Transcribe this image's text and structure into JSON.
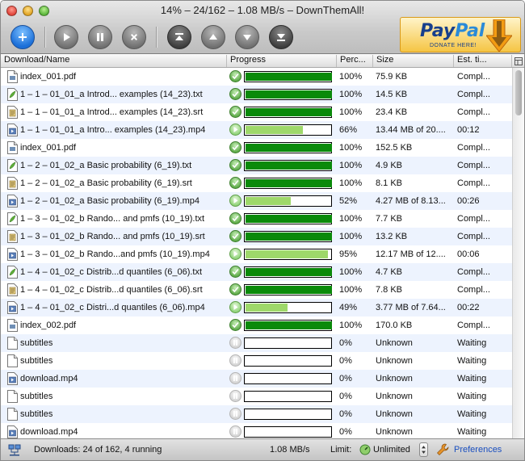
{
  "window": {
    "title": "14% – 24/162 – 1.08 MB/s – DownThemAll!"
  },
  "toolbar": {
    "buttons": [
      "add-icon",
      "resume-icon",
      "pause-icon",
      "cancel-icon",
      "move-top-icon",
      "move-up-icon",
      "move-down-icon",
      "move-bottom-icon"
    ]
  },
  "donate": {
    "brand_pay": "Pay",
    "brand_pal": "Pal",
    "label": "DONATE HERE!"
  },
  "columns": {
    "name": "Download/Name",
    "progress": "Progress",
    "percent": "Perc...",
    "size": "Size",
    "est": "Est. ti..."
  },
  "rows": [
    {
      "icon": "pdf",
      "name": "index_001.pdf",
      "state": "done",
      "progress": 1.0,
      "percent": "100%",
      "size": "75.9 KB",
      "est": "Compl..."
    },
    {
      "icon": "txt",
      "name": "1 – 1 – 01_01_a Introd... examples (14_23).txt",
      "state": "done",
      "progress": 1.0,
      "percent": "100%",
      "size": "14.5 KB",
      "est": "Compl..."
    },
    {
      "icon": "srt",
      "name": "1 – 1 – 01_01_a Introd... examples (14_23).srt",
      "state": "done",
      "progress": 1.0,
      "percent": "100%",
      "size": "23.4 KB",
      "est": "Compl..."
    },
    {
      "icon": "mp4",
      "name": "1 – 1 – 01_01_a Intro... examples (14_23).mp4",
      "state": "run",
      "progress": 0.66,
      "percent": "66%",
      "size": "13.44 MB of 20....",
      "est": "00:12"
    },
    {
      "icon": "pdf",
      "name": "index_001.pdf",
      "state": "done",
      "progress": 1.0,
      "percent": "100%",
      "size": "152.5 KB",
      "est": "Compl..."
    },
    {
      "icon": "txt",
      "name": "1 – 2 – 01_02_a Basic probability  (6_19).txt",
      "state": "done",
      "progress": 1.0,
      "percent": "100%",
      "size": "4.9 KB",
      "est": "Compl..."
    },
    {
      "icon": "srt",
      "name": "1 – 2 – 01_02_a Basic probability  (6_19).srt",
      "state": "done",
      "progress": 1.0,
      "percent": "100%",
      "size": "8.1 KB",
      "est": "Compl..."
    },
    {
      "icon": "mp4",
      "name": "1 – 2 – 01_02_a Basic probability  (6_19).mp4",
      "state": "run",
      "progress": 0.52,
      "percent": "52%",
      "size": "4.27 MB of 8.13...",
      "est": "00:26"
    },
    {
      "icon": "txt",
      "name": "1 – 3 – 01_02_b Rando... and pmfs (10_19).txt",
      "state": "done",
      "progress": 1.0,
      "percent": "100%",
      "size": "7.7 KB",
      "est": "Compl..."
    },
    {
      "icon": "srt",
      "name": "1 – 3 – 01_02_b Rando... and pmfs (10_19).srt",
      "state": "done",
      "progress": 1.0,
      "percent": "100%",
      "size": "13.2 KB",
      "est": "Compl..."
    },
    {
      "icon": "mp4",
      "name": "1 – 3 – 01_02_b Rando...and pmfs (10_19).mp4",
      "state": "run",
      "progress": 0.95,
      "percent": "95%",
      "size": "12.17 MB of 12....",
      "est": "00:06"
    },
    {
      "icon": "txt",
      "name": "1 – 4 – 01_02_c Distrib...d quantiles (6_06).txt",
      "state": "done",
      "progress": 1.0,
      "percent": "100%",
      "size": "4.7 KB",
      "est": "Compl..."
    },
    {
      "icon": "srt",
      "name": "1 – 4 – 01_02_c Distrib...d quantiles (6_06).srt",
      "state": "done",
      "progress": 1.0,
      "percent": "100%",
      "size": "7.8 KB",
      "est": "Compl..."
    },
    {
      "icon": "mp4",
      "name": "1 – 4 – 01_02_c Distri...d quantiles (6_06).mp4",
      "state": "run",
      "progress": 0.49,
      "percent": "49%",
      "size": "3.77 MB of 7.64...",
      "est": "00:22"
    },
    {
      "icon": "pdf",
      "name": "index_002.pdf",
      "state": "done",
      "progress": 1.0,
      "percent": "100%",
      "size": "170.0 KB",
      "est": "Compl..."
    },
    {
      "icon": "blank",
      "name": "subtitles",
      "state": "wait",
      "progress": 0,
      "percent": "0%",
      "size": "Unknown",
      "est": "Waiting"
    },
    {
      "icon": "blank",
      "name": "subtitles",
      "state": "wait",
      "progress": 0,
      "percent": "0%",
      "size": "Unknown",
      "est": "Waiting"
    },
    {
      "icon": "mp4",
      "name": "download.mp4",
      "state": "wait",
      "progress": 0,
      "percent": "0%",
      "size": "Unknown",
      "est": "Waiting"
    },
    {
      "icon": "blank",
      "name": "subtitles",
      "state": "wait",
      "progress": 0,
      "percent": "0%",
      "size": "Unknown",
      "est": "Waiting"
    },
    {
      "icon": "blank",
      "name": "subtitles",
      "state": "wait",
      "progress": 0,
      "percent": "0%",
      "size": "Unknown",
      "est": "Waiting"
    },
    {
      "icon": "mp4",
      "name": "download.mp4",
      "state": "wait",
      "progress": 0,
      "percent": "0%",
      "size": "Unknown",
      "est": "Waiting"
    }
  ],
  "statusbar": {
    "downloads": "Downloads: 24 of 162, 4 running",
    "speed": "1.08 MB/s",
    "limit_label": "Limit:",
    "limit_value": "Unlimited",
    "preferences": "Preferences"
  },
  "colors": {
    "progress_done": "#0a8a0a",
    "progress_running": "#9ed86a",
    "row_alt": "#edf3fe",
    "link": "#1a4fbf"
  }
}
